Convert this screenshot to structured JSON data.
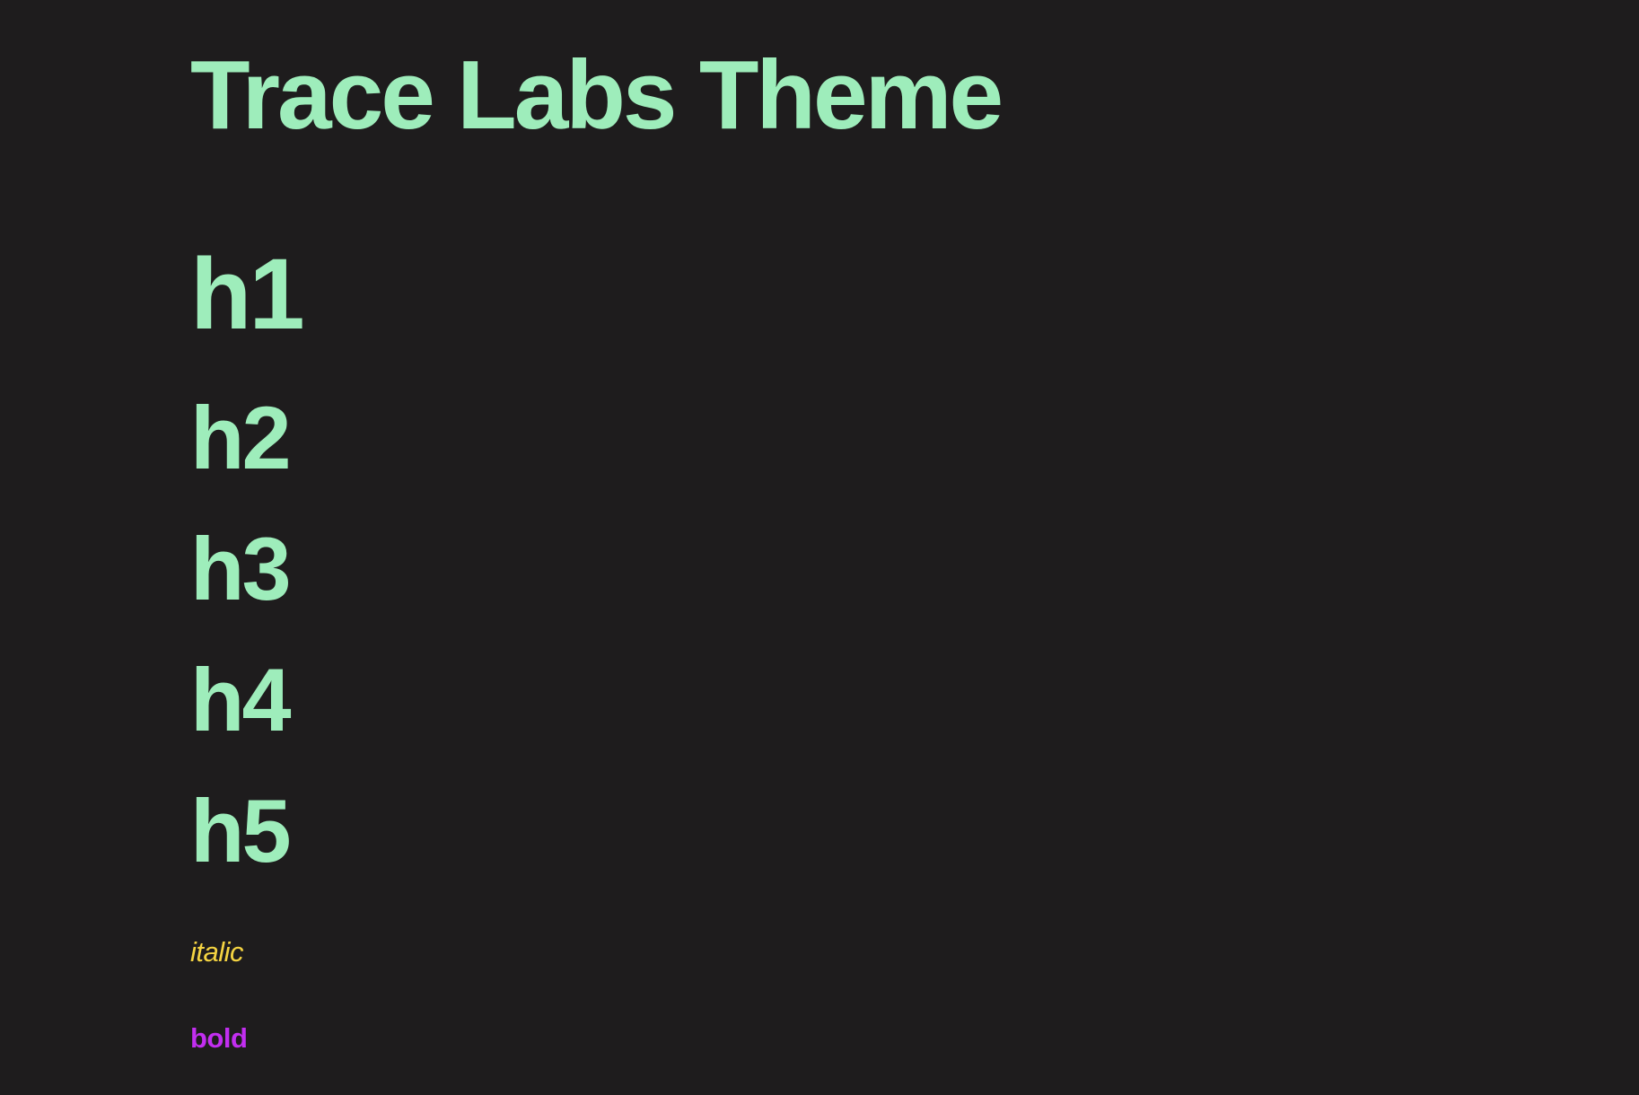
{
  "document": {
    "title": "Trace Labs Theme",
    "headings": [
      "h1",
      "h2",
      "h3",
      "h4",
      "h5"
    ],
    "italic_text": "italic",
    "bold_text": "bold"
  },
  "colors": {
    "background": "#1e1c1d",
    "heading": "#9eedbb",
    "italic": "#f5d442",
    "bold": "#c22ef0"
  }
}
